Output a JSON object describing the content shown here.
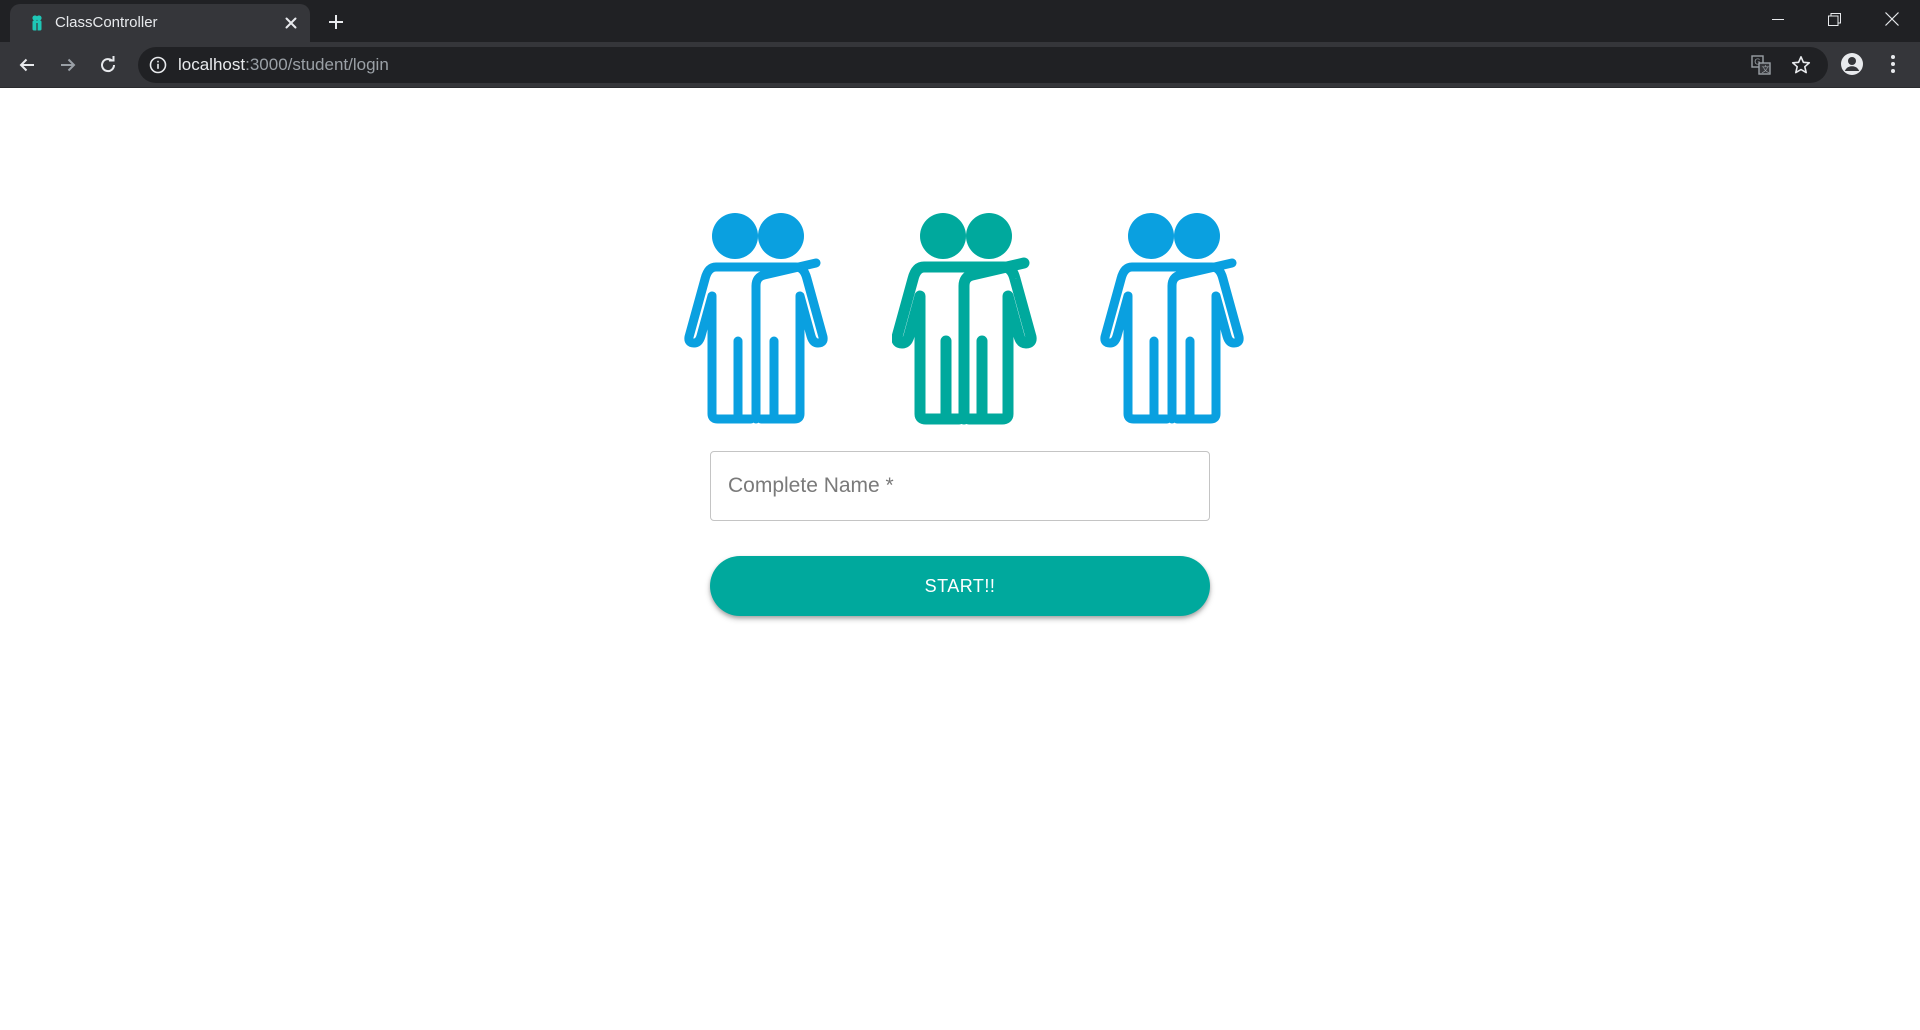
{
  "browser": {
    "tab": {
      "title": "ClassController",
      "favicon": "classcontroller-favicon"
    },
    "address_bar": {
      "host": "localhost",
      "path": ":3000/student/login"
    },
    "icons": {
      "back": "back-arrow-icon",
      "forward": "forward-arrow-icon",
      "reload": "reload-icon",
      "info": "info-icon",
      "translate": "translate-icon",
      "bookmark": "star-icon",
      "profile": "account-icon",
      "menu": "more-vert-icon",
      "new_tab": "plus-icon",
      "close_tab": "close-icon",
      "minimize": "minimize-icon",
      "restore": "restore-icon",
      "close_window": "close-icon"
    }
  },
  "login": {
    "logo": {
      "icons": [
        "friends-icon",
        "friends-icon",
        "friends-icon"
      ],
      "colors": [
        "#0aa0e0",
        "#00a99d",
        "#0aa0e0"
      ]
    },
    "name_field": {
      "placeholder": "Complete Name *",
      "value": ""
    },
    "start_button": {
      "label": "START!!",
      "color": "#00a99d"
    }
  },
  "theme": {
    "chrome_dark": "#202124",
    "chrome_toolbar": "#35363a",
    "accent_blue": "#0aa0e0",
    "accent_teal": "#00a99d"
  }
}
